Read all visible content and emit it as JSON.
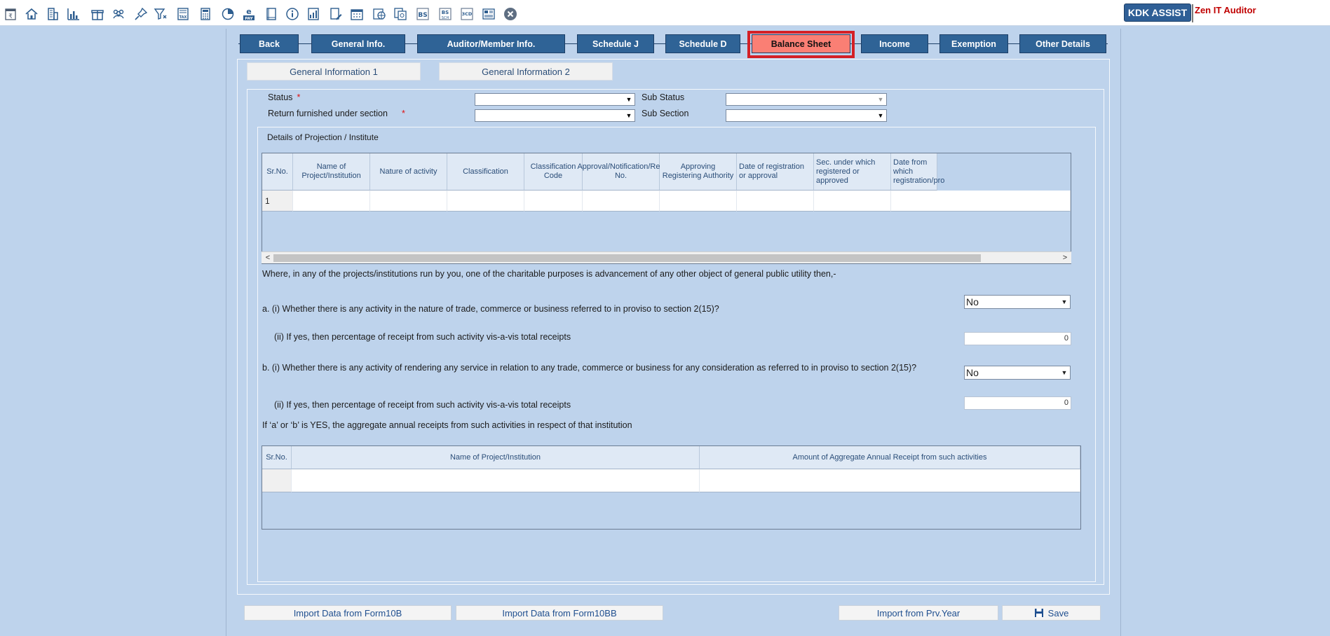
{
  "toolbar": {
    "icons": [
      "rupee-doc-icon",
      "home-icon",
      "building-icon",
      "bar-chart-icon",
      "gift-icon",
      "group-icon",
      "pin-icon",
      "filter-icon",
      "tax-icon",
      "calculator-icon",
      "pie-chart-icon",
      "epay-icon",
      "book-icon",
      "info-icon",
      "report-icon",
      "doc-edit-icon",
      "calendar-icon",
      "globe-icon",
      "copy-icon",
      "bs-icon",
      "bs-sch-icon",
      "3cd-icon",
      "form-icon",
      "close-icon"
    ],
    "tax_label": "TAX",
    "pay_label": "PAY",
    "bs_label": "BS",
    "bs_sch_label": "BS",
    "bs_sch_sub": "SCH",
    "cd_label": "3CD",
    "brand_button": "KDK ASSIST",
    "brand_text": "Zen IT Auditor"
  },
  "tabs": [
    {
      "label": "Back"
    },
    {
      "label": "General Info."
    },
    {
      "label": "Auditor/Member Info."
    },
    {
      "label": "Schedule J"
    },
    {
      "label": "Schedule D"
    },
    {
      "label": "Balance Sheet"
    },
    {
      "label": "Income"
    },
    {
      "label": "Exemption"
    },
    {
      "label": "Other Details"
    }
  ],
  "subtabs": [
    {
      "label": "General Information 1"
    },
    {
      "label": "General Information 2"
    }
  ],
  "form": {
    "status_label": "Status",
    "required_mark": "*",
    "return_label": "Return furnished under section",
    "sub_status_label": "Sub Status",
    "sub_section_label": "Sub Section",
    "status_value": "",
    "return_value": "",
    "sub_status_value": "",
    "sub_section_value": ""
  },
  "projects": {
    "group_title": "Details of Projection / Institute",
    "columns": [
      "Sr.No.",
      "Name of Project/Institution",
      "Nature of activity",
      "Classification",
      "Classification Code",
      "Approval/Notification/Reg No.",
      "Approving Registering Authority",
      "Date of registration or approval",
      "Sec. under which registered or approved",
      "Date from which registration/pro"
    ],
    "rows": [
      {
        "sr": "1",
        "cells": [
          "",
          "",
          "",
          "",
          "",
          "",
          "",
          "",
          ""
        ]
      }
    ],
    "scroll_left": "<",
    "scroll_right": ">"
  },
  "questions": {
    "intro": "Where, in any of the projects/institutions run by you, one of the charitable purposes is advancement of any other object of general public utility then,-",
    "a_i": "a. (i) Whether there is any activity in the nature of trade, commerce or business referred to in proviso to section 2(15)?",
    "a_i_value": "No",
    "a_ii": "(ii) If yes, then percentage of receipt from such activity vis-a-vis total receipts",
    "a_ii_value": "0",
    "b_i": "b. (i) Whether there is any activity of rendering any service in relation to any trade, commerce or business for any consideration as referred to in proviso to section 2(15)?",
    "b_i_value": "No",
    "b_ii": "(ii) If yes, then percentage of receipt from such activity vis-a-vis total receipts",
    "b_ii_value": "0",
    "aggregate_note": "If ‘a’ or ‘b’ is YES, the aggregate annual receipts from such activities in respect of that institution"
  },
  "aggregate": {
    "columns": [
      "Sr.No.",
      "Name of Project/Institution",
      "Amount of Aggregate Annual Receipt from such activities"
    ],
    "rows": [
      {
        "sr": "",
        "name": "",
        "amount": ""
      }
    ]
  },
  "buttons": {
    "import_10b": "Import Data from Form10B",
    "import_10bb": "Import Data from Form10BB",
    "import_prev": "Import from Prv.Year",
    "save": "Save"
  },
  "colors": {
    "tab_bg": "#2f6396",
    "active_tab_bg": "#fa7f74",
    "highlight_border": "#d42026",
    "background": "#bed3ec",
    "brand": "#2f5f96",
    "brand_text": "#c00000"
  }
}
